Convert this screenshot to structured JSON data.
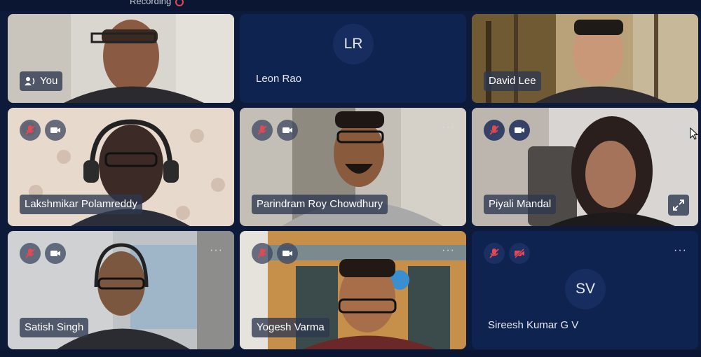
{
  "header": {
    "recording_label": "Recording"
  },
  "tiles": [
    {
      "name": "You"
    },
    {
      "name": "Leon Rao",
      "initials": "LR"
    },
    {
      "name": "David Lee"
    },
    {
      "name": "Lakshmikar Polamreddy"
    },
    {
      "name": "Parindram Roy Chowdhury"
    },
    {
      "name": "Piyali Mandal"
    },
    {
      "name": "Satish Singh"
    },
    {
      "name": "Yogesh Varma"
    },
    {
      "name": "Sireesh Kumar G V",
      "initials": "SV"
    }
  ],
  "icons": {
    "mic_muted": "mic-muted-icon",
    "camera": "camera-icon",
    "camera_off": "camera-off-icon",
    "more": "more-options-icon",
    "expand": "expand-icon",
    "speaker": "speaker-icon"
  },
  "colors": {
    "background": "#0d1a3a",
    "tile_dark": "#0f2350",
    "muted_red": "#e14a55"
  }
}
